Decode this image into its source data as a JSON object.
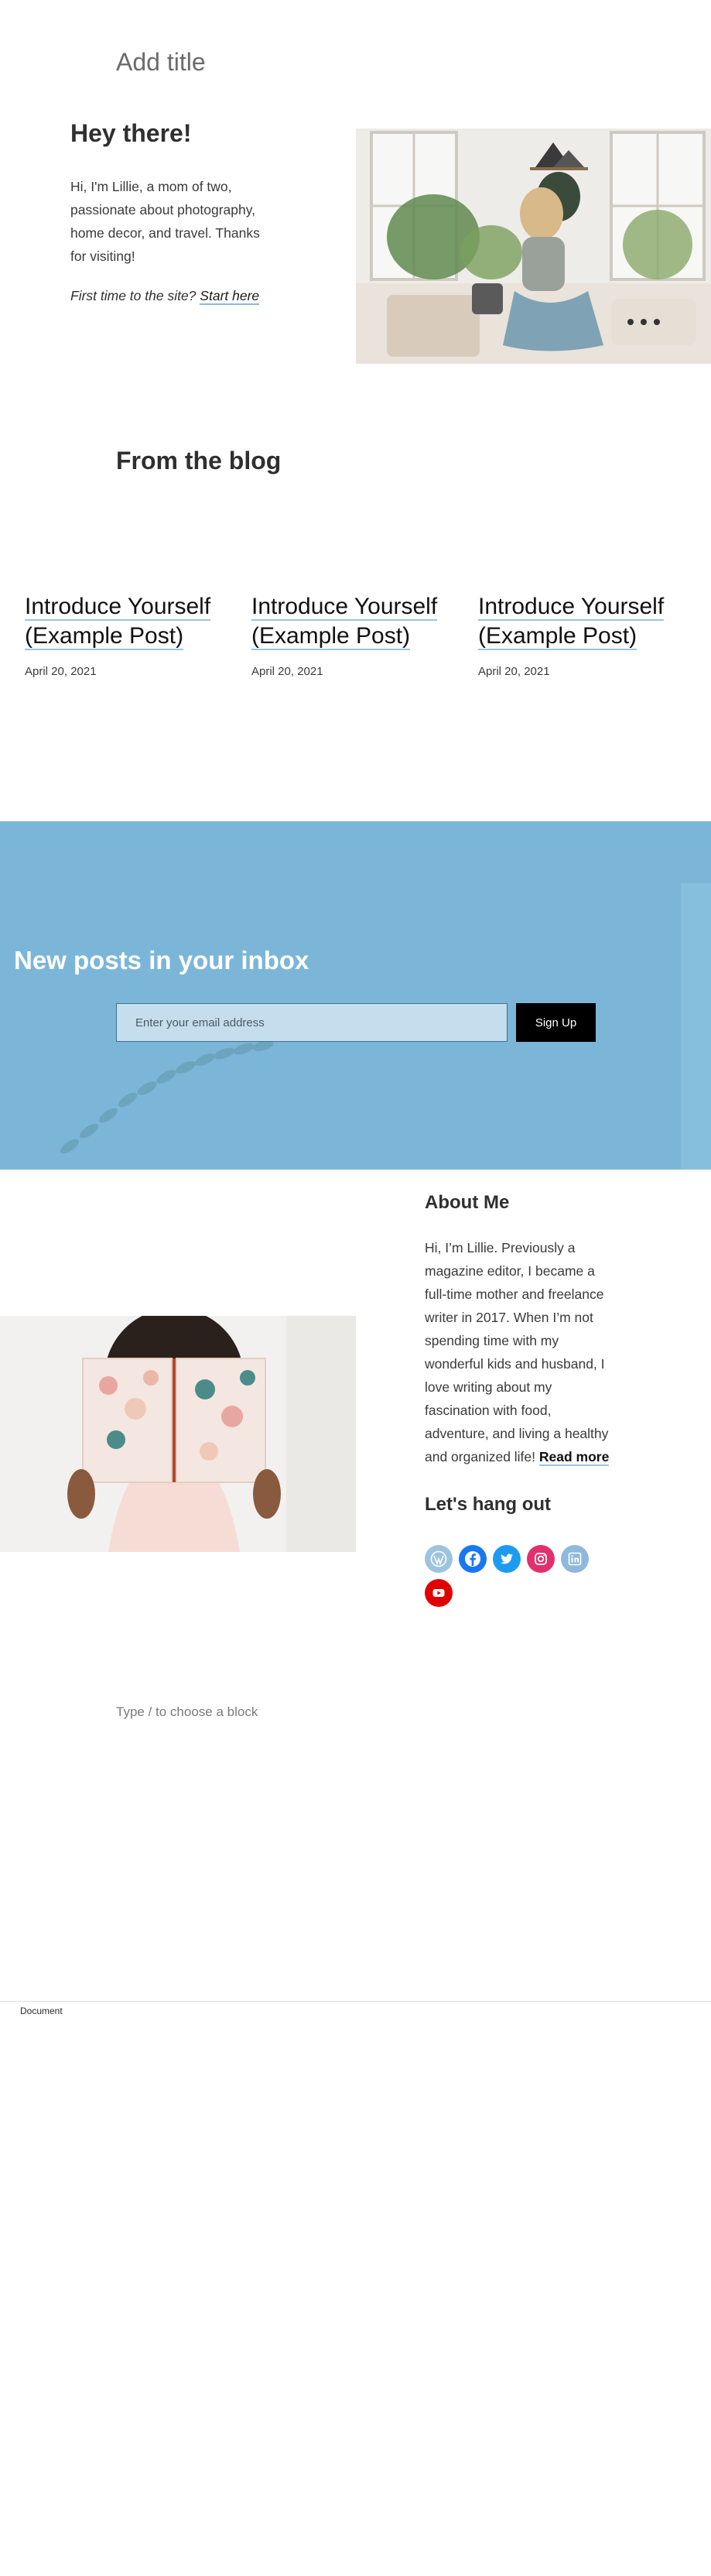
{
  "editor": {
    "title_placeholder": "Add title",
    "block_placeholder": "Type / to choose a block",
    "footer_label": "Document"
  },
  "intro": {
    "heading": "Hey there!",
    "body": "Hi, I'm Lillie, a mom of two, passionate about photography, home decor, and travel. Thanks for visiting!",
    "cta_prefix": "First time to the site?",
    "cta_link": "Start here"
  },
  "blog": {
    "heading": "From the blog",
    "posts": [
      {
        "title": "Introduce Yourself (Example Post)",
        "date": "April 20, 2021"
      },
      {
        "title": "Introduce Yourself (Example Post)",
        "date": "April 20, 2021"
      },
      {
        "title": "Introduce Yourself (Example Post)",
        "date": "April 20, 2021"
      }
    ]
  },
  "subscribe": {
    "heading": "New posts in your inbox",
    "email_placeholder": "Enter your email address",
    "button_label": "Sign Up",
    "bg_color": "#7bb6d8"
  },
  "about": {
    "heading": "About Me",
    "body": "Hi, I’m Lillie. Previously a magazine editor, I became a full-time mother and freelance writer in 2017. When I’m not spending time with my wonderful kids and husband, I love writing about my fascination with food, adventure, and living a healthy and organized life!",
    "read_more": "Read more",
    "social_heading": "Let's hang out",
    "socials": [
      {
        "name": "wordpress-icon",
        "color": "#9cc4df"
      },
      {
        "name": "facebook-icon",
        "color": "#1877f2"
      },
      {
        "name": "twitter-icon",
        "color": "#1d9bf0"
      },
      {
        "name": "instagram-icon",
        "color": "#e1306c"
      },
      {
        "name": "linkedin-icon",
        "color": "#8fb8dc"
      },
      {
        "name": "youtube-icon",
        "color": "#e00000"
      }
    ]
  }
}
